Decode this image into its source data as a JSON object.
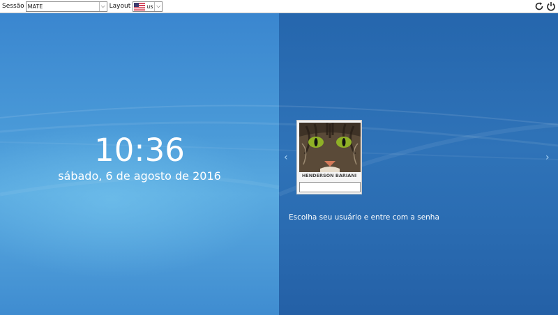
{
  "topbar": {
    "session_label": "Sessão",
    "session_value": "MATE",
    "layout_label": "Layout",
    "layout_value": "us",
    "layout_flag": "us-flag-icon",
    "restart_icon": "restart-icon",
    "shutdown_icon": "power-icon"
  },
  "clock": {
    "time": "10:36",
    "date": "sábado, 6 de agosto de 2016"
  },
  "user_card": {
    "name": "HENDERSON BARIANI",
    "avatar_icon": "cat-avatar",
    "password_value": ""
  },
  "nav": {
    "prev": "‹",
    "next": "›"
  },
  "prompt": "Escolha seu usuário e entre com a senha",
  "colors": {
    "left_panel": "#4a9ad8",
    "right_panel": "#2f73b8",
    "text": "#ffffff"
  }
}
